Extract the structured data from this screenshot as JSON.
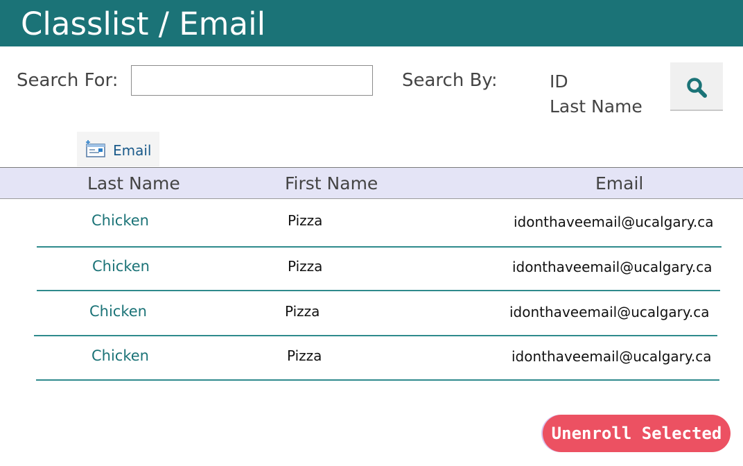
{
  "header": {
    "title": "Classlist / Email"
  },
  "search": {
    "for_label": "Search For:",
    "value": "",
    "placeholder": "",
    "by_label": "Search By:",
    "by_options": [
      "ID",
      "Last Name"
    ],
    "button_icon": "magnifier-icon"
  },
  "toolbar": {
    "email_label": "Email",
    "email_icon": "email-compose-icon"
  },
  "table": {
    "columns": [
      "Last Name",
      "First Name",
      "Email"
    ],
    "rows": [
      {
        "last_name": "Chicken",
        "first_name": "Pizza",
        "email": "idonthaveemail@ucalgary.ca"
      },
      {
        "last_name": "Chicken",
        "first_name": "Pizza",
        "email": "idonthaveemail@ucalgary.ca"
      },
      {
        "last_name": "Chicken",
        "first_name": "Pizza",
        "email": "idonthaveemail@ucalgary.ca"
      },
      {
        "last_name": "Chicken",
        "first_name": "Pizza",
        "email": "idonthaveemail@ucalgary.ca"
      }
    ]
  },
  "actions": {
    "unenroll_label": "Unenroll Selected"
  },
  "colors": {
    "header_bg": "#1b7377",
    "table_header_bg": "#e4e4f6",
    "row_divider": "#2e8a8c",
    "link": "#1b7377",
    "unenroll_bg": "#ec5162"
  }
}
